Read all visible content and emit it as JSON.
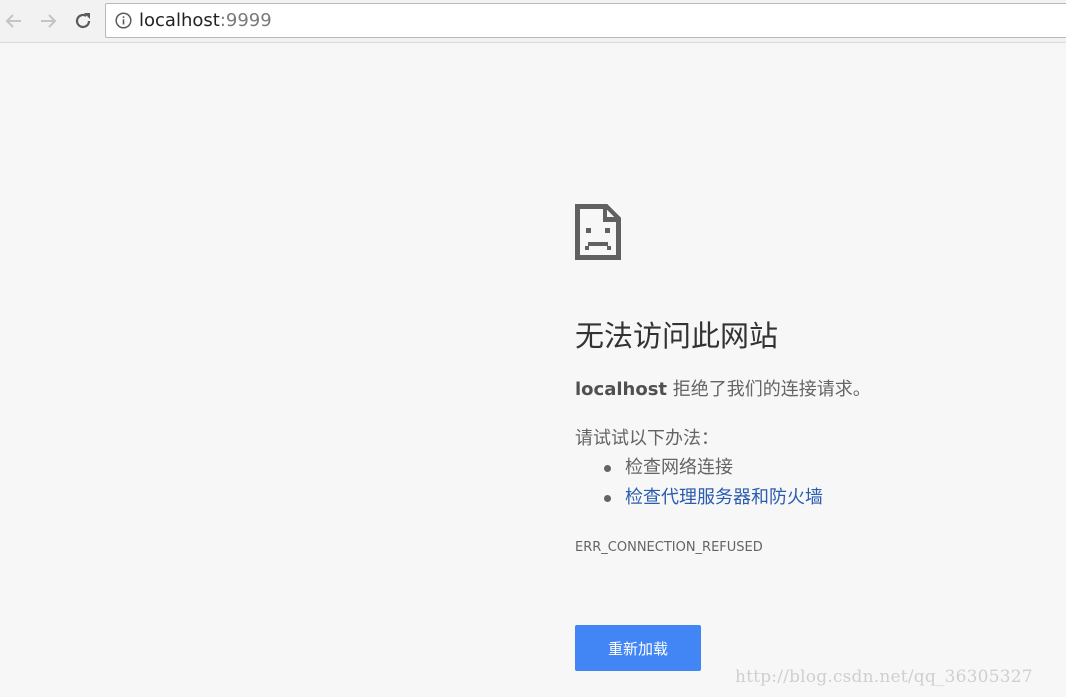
{
  "toolbar": {
    "back_icon": "back-arrow-icon",
    "forward_icon": "forward-arrow-icon",
    "reload_icon": "reload-icon",
    "address": {
      "info_icon": "info-icon",
      "host": "localhost",
      "port": ":9999"
    }
  },
  "error_page": {
    "icon": "sad-document-icon",
    "heading": "无法访问此网站",
    "summary_host": "localhost",
    "summary_text": " 拒绝了我们的连接请求。",
    "suggestions_title": "请试试以下办法：",
    "suggestions": [
      {
        "label": "检查网络连接",
        "is_link": false
      },
      {
        "label": "检查代理服务器和防火墙",
        "is_link": true
      }
    ],
    "error_code": "ERR_CONNECTION_REFUSED",
    "reload_button": "重新加载"
  },
  "watermark": "http://blog.csdn.net/qq_36305327",
  "colors": {
    "page_background": "#f7f7f7",
    "button_blue": "#4285f4",
    "link_blue": "#2a5db0",
    "text_gray": "#646464"
  }
}
